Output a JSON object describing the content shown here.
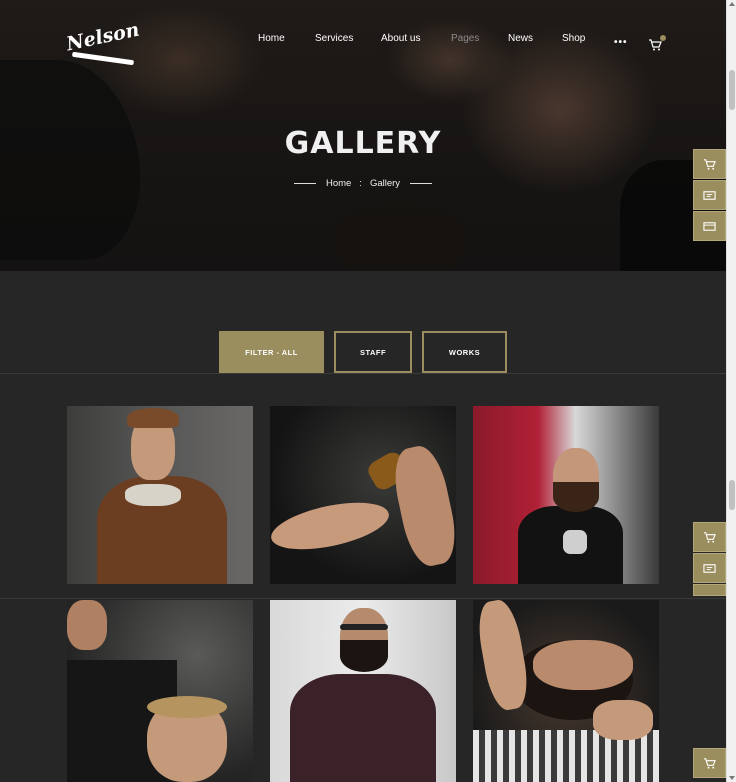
{
  "brand": {
    "logo_text": "Nelson"
  },
  "nav": {
    "items": [
      {
        "label": "Home",
        "state": "normal"
      },
      {
        "label": "Services",
        "state": "normal"
      },
      {
        "label": "About us",
        "state": "normal"
      },
      {
        "label": "Pages",
        "state": "muted"
      },
      {
        "label": "News",
        "state": "normal"
      },
      {
        "label": "Shop",
        "state": "normal"
      }
    ],
    "more_label": "•••",
    "cart_icon": "cart-icon"
  },
  "hero": {
    "title": "GALLERY",
    "breadcrumb": {
      "home": "Home",
      "separator": ":",
      "current": "Gallery"
    }
  },
  "filters": [
    {
      "label": "FILTER - ALL",
      "active": true
    },
    {
      "label": "STAFF",
      "active": false
    },
    {
      "label": "WORKS",
      "active": false
    }
  ],
  "side_tools": [
    "cart-icon",
    "id-card-icon",
    "browser-window-icon"
  ],
  "gallery": [
    {
      "subject": "man-in-shearling-jacket-photo"
    },
    {
      "subject": "dropper-bottle-hands-photo"
    },
    {
      "subject": "bearded-man-raiders-shirt-photo"
    },
    {
      "subject": "barber-cutting-hair-photo"
    },
    {
      "subject": "man-with-glasses-buttoning-shirt-photo"
    },
    {
      "subject": "beard-shave-photo"
    }
  ],
  "colors": {
    "accent": "#9b8e5e",
    "background": "#262626",
    "nav_muted": "#8a8a8a"
  }
}
